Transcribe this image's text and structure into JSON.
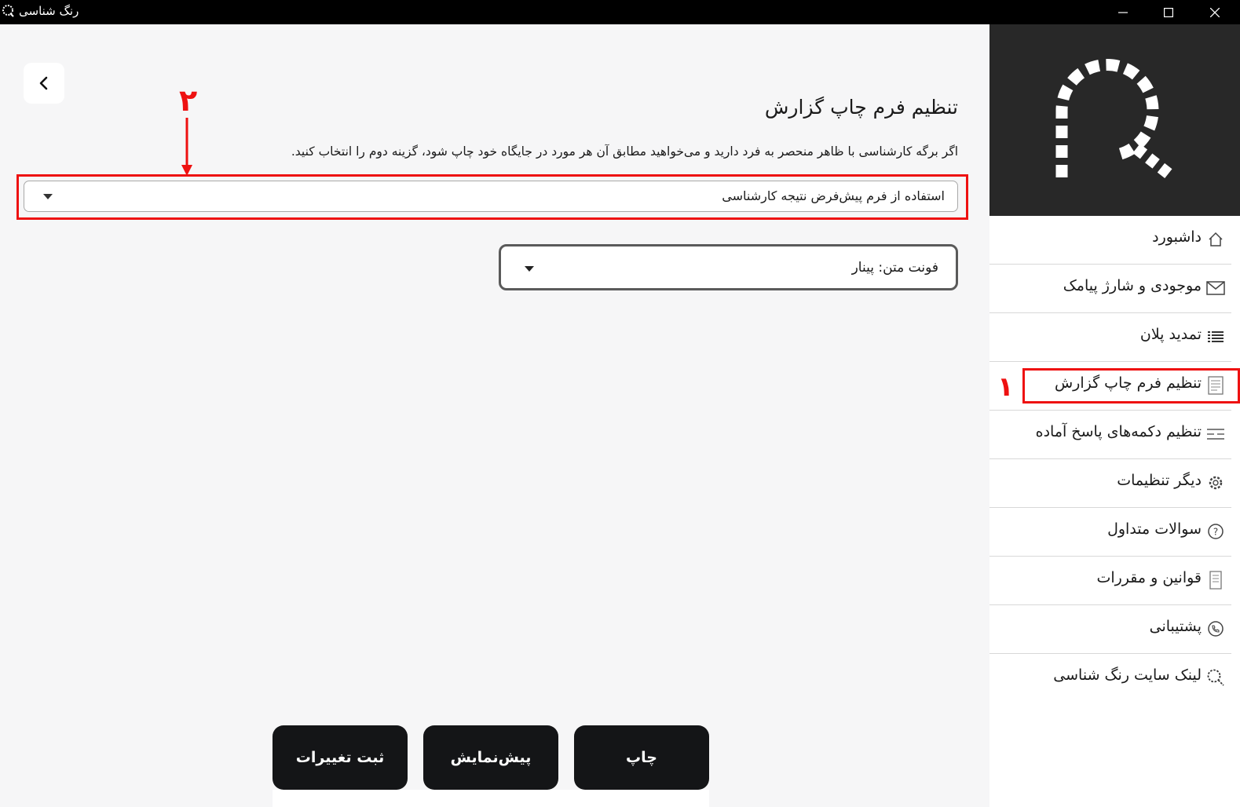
{
  "window": {
    "title": "رنگ شناسی"
  },
  "main": {
    "page_title": "تنظیم فرم چاپ گزارش",
    "description": "اگر برگه کارشناسی با ظاهر منحصر به فرد دارید و می‌خواهید مطابق آن هر مورد در جایگاه خود چاپ شود، گزینه دوم را انتخاب کنید.",
    "form_select": {
      "selected": "استفاده از فرم پیش‌فرض نتیجه کارشناسی"
    },
    "font_select": {
      "selected": "فونت متن: پینار"
    },
    "buttons": {
      "save": "ثبت تغییرات",
      "preview": "پیش‌نمایش",
      "print": "چاپ"
    }
  },
  "annotations": {
    "marker_1": "۱",
    "marker_2": "۲",
    "color": "#ee1111"
  },
  "sidebar": {
    "items": [
      {
        "label": "داشبورد",
        "icon": "home-icon"
      },
      {
        "label": "موجودی و شارژ پیامک",
        "icon": "mail-icon"
      },
      {
        "label": "تمدید پلان",
        "icon": "list-icon"
      },
      {
        "label": "تنظیم فرم چاپ گزارش",
        "icon": "report-form-icon"
      },
      {
        "label": "تنظیم دکمه‌های پاسخ آماده",
        "icon": "sliders-icon"
      },
      {
        "label": "دیگر تنظیمات",
        "icon": "gear-icon"
      },
      {
        "label": "سوالات متداول",
        "icon": "question-icon"
      },
      {
        "label": "قوانین و مقررات",
        "icon": "document-icon"
      },
      {
        "label": "پشتیبانی",
        "icon": "phone-icon"
      },
      {
        "label": "لینک سایت رنگ شناسی",
        "icon": "search-link-icon"
      }
    ]
  }
}
